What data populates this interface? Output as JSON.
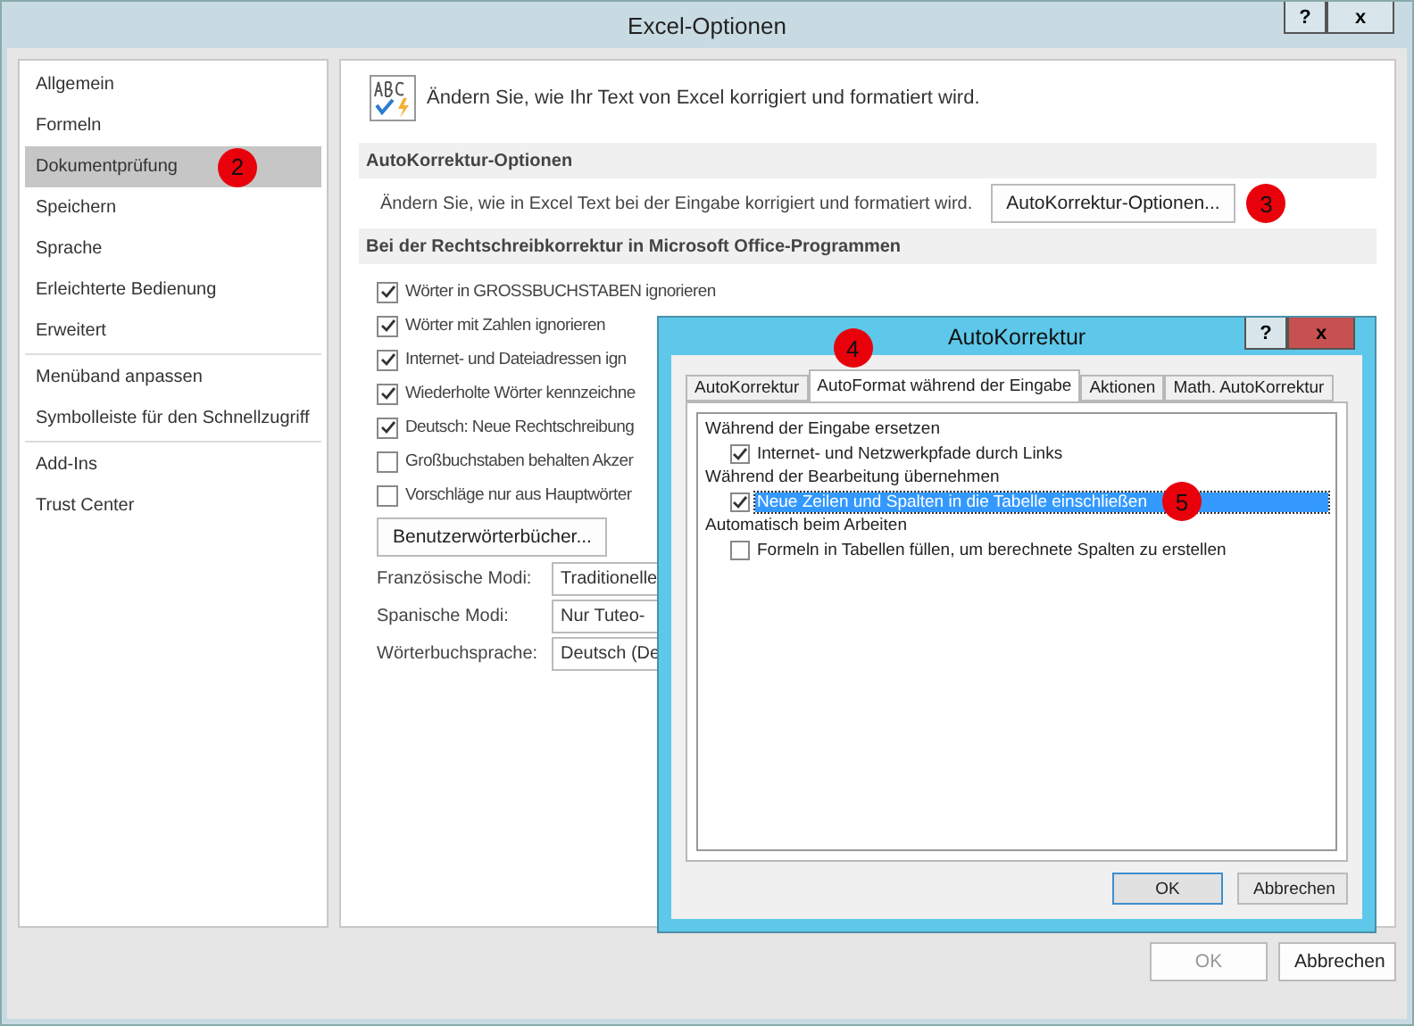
{
  "window": {
    "title": "Excel-Optionen",
    "controls": [
      "?",
      "x"
    ]
  },
  "sidebar": {
    "groups": [
      [
        {
          "label": "Allgemein",
          "selected": false
        },
        {
          "label": "Formeln",
          "selected": false
        },
        {
          "label": "Dokumentprüfung",
          "selected": true,
          "marker": "2"
        },
        {
          "label": "Speichern",
          "selected": false
        },
        {
          "label": "Sprache",
          "selected": false
        },
        {
          "label": "Erleichterte Bedienung",
          "selected": false
        },
        {
          "label": "Erweitert",
          "selected": false
        }
      ],
      [
        {
          "label": "Menüband anpassen",
          "selected": false
        },
        {
          "label": "Symbolleiste für den Schnellzugriff",
          "selected": false
        }
      ],
      [
        {
          "label": "Add-Ins",
          "selected": false
        },
        {
          "label": "Trust Center",
          "selected": false
        }
      ]
    ]
  },
  "content": {
    "intro": "Ändern Sie, wie Ihr Text von Excel korrigiert und formatiert wird.",
    "autocorrect_section": {
      "title": "AutoKorrektur-Optionen",
      "description": "Ändern Sie, wie in Excel Text bei der Eingabe korrigiert und formatiert wird.",
      "button": "AutoKorrektur-Optionen...",
      "marker": "3"
    },
    "spelling_section": {
      "title": "Bei der Rechtschreibkorrektur in Microsoft Office-Programmen",
      "options": [
        {
          "label": "Wörter in GROSSBUCHSTABEN ignorieren",
          "checked": true
        },
        {
          "label": "Wörter mit Zahlen ignorieren",
          "checked": true
        },
        {
          "label": "Internet- und Dateiadressen ign",
          "checked": true
        },
        {
          "label": "Wiederholte Wörter kennzeichne",
          "checked": true
        },
        {
          "label": "Deutsch: Neue Rechtschreibung",
          "checked": true
        },
        {
          "label": "Großbuchstaben behalten Akzer",
          "checked": false
        },
        {
          "label": "Vorschläge nur aus Hauptwörter",
          "checked": false
        }
      ],
      "dictionaries_button": "Benutzerwörterbücher...",
      "dropdowns": [
        {
          "label": "Französische Modi:",
          "value": "Traditionelle"
        },
        {
          "label": "Spanische Modi:",
          "value": "Nur Tuteo-"
        },
        {
          "label": "Wörterbuchsprache:",
          "value": "Deutsch (De"
        }
      ]
    }
  },
  "footer": {
    "buttons": [
      {
        "label": "OK",
        "disabled": true
      },
      {
        "label": "Abbrechen",
        "disabled": false
      }
    ]
  },
  "dialog": {
    "title": "AutoKorrektur",
    "controls": [
      "?",
      "x"
    ],
    "tabs": [
      {
        "label": "AutoKorrektur",
        "selected": false
      },
      {
        "label": "AutoFormat während der Eingabe",
        "selected": true,
        "marker": "4"
      },
      {
        "label": "Aktionen",
        "selected": false
      },
      {
        "label": "Math. AutoKorrektur",
        "selected": false
      }
    ],
    "groups": [
      {
        "heading": "Während der Eingabe ersetzen",
        "options": [
          {
            "label": "Internet- und Netzwerkpfade durch Links",
            "checked": true,
            "selected": false
          }
        ]
      },
      {
        "heading": "Während der Bearbeitung übernehmen",
        "options": [
          {
            "label": "Neue Zeilen und Spalten in die Tabelle einschließen",
            "checked": true,
            "selected": true,
            "marker": "5"
          }
        ]
      },
      {
        "heading": "Automatisch beim Arbeiten",
        "options": [
          {
            "label": "Formeln in Tabellen füllen, um berechnete Spalten zu erstellen",
            "checked": false,
            "selected": false
          }
        ]
      }
    ],
    "buttons": [
      {
        "label": "OK",
        "default": true
      },
      {
        "label": "Abbrechen",
        "default": false
      }
    ]
  }
}
